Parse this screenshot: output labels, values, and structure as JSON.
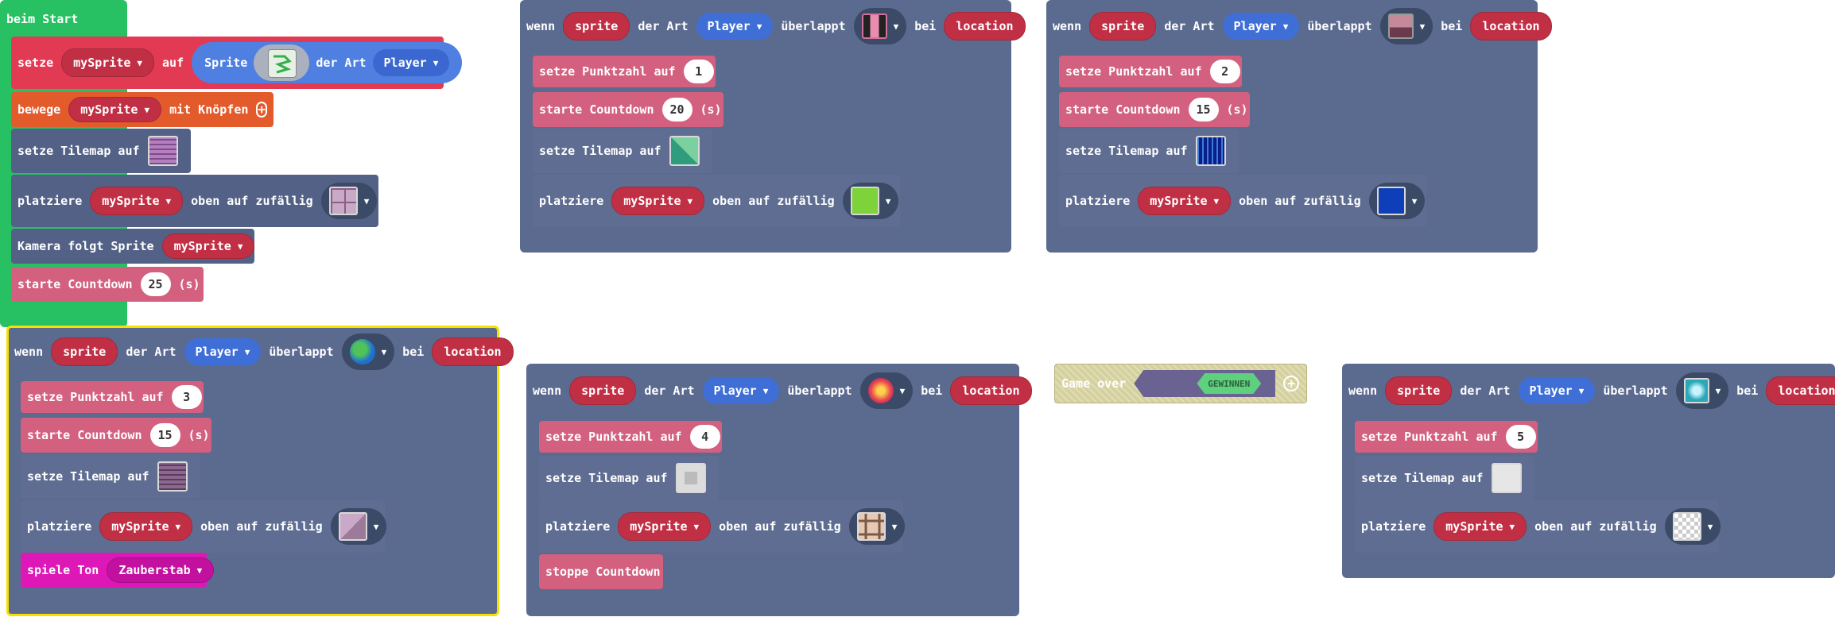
{
  "start_block": {
    "hat": "beim Start",
    "set_sprite": {
      "kw_set": "setze",
      "var": "mySprite",
      "kw_to": "auf",
      "kw_sprite": "Sprite",
      "kw_kind": "der Art",
      "kind": "Player"
    },
    "move": {
      "kw": "bewege",
      "var": "mySprite",
      "kw2": "mit Knöpfen"
    },
    "tilemap": {
      "kw": "setze Tilemap auf"
    },
    "place": {
      "kw": "platziere",
      "var": "mySprite",
      "kw2": "oben auf zufällig"
    },
    "camera": {
      "kw": "Kamera folgt Sprite",
      "var": "mySprite"
    },
    "countdown": {
      "kw": "starte Countdown",
      "value": "25",
      "unit": "(s)"
    }
  },
  "overlap_common": {
    "kw_when": "wenn",
    "sprite": "sprite",
    "kw_kind": "der Art",
    "kind": "Player",
    "kw_overlap": "überlappt",
    "kw_at": "bei",
    "location": "location"
  },
  "handlers": [
    {
      "score_label": "setze Punktzahl auf",
      "score": "1",
      "countdown_label": "starte Countdown",
      "countdown": "20",
      "unit": "(s)",
      "tilemap_label": "setze Tilemap auf",
      "place_label": "platziere",
      "var": "mySprite",
      "place_label2": "oben auf zufällig"
    },
    {
      "score_label": "setze Punktzahl auf",
      "score": "2",
      "countdown_label": "starte Countdown",
      "countdown": "15",
      "unit": "(s)",
      "tilemap_label": "setze Tilemap auf",
      "place_label": "platziere",
      "var": "mySprite",
      "place_label2": "oben auf zufällig"
    },
    {
      "score_label": "setze Punktzahl auf",
      "score": "3",
      "countdown_label": "starte Countdown",
      "countdown": "15",
      "unit": "(s)",
      "tilemap_label": "setze Tilemap auf",
      "place_label": "platziere",
      "var": "mySprite",
      "place_label2": "oben auf zufällig",
      "sound_label": "spiele Ton",
      "sound": "Zauberstab"
    },
    {
      "score_label": "setze Punktzahl auf",
      "score": "4",
      "tilemap_label": "setze Tilemap auf",
      "place_label": "platziere",
      "var": "mySprite",
      "place_label2": "oben auf zufällig",
      "stop_label": "stoppe Countdown"
    },
    {
      "score_label": "setze Punktzahl auf",
      "score": "5",
      "tilemap_label": "setze Tilemap auf",
      "place_label": "platziere",
      "var": "mySprite",
      "place_label2": "oben auf zufällig"
    }
  ],
  "game_over": {
    "label": "Game over",
    "value": "GEWINNEN"
  },
  "colors": {
    "events": "#27c063",
    "overlap": "#526185",
    "info": "#d3607f",
    "sprites": "#e23a52",
    "controller": "#e35a2b",
    "music": "#de18b6",
    "kind": "#3f6fd6",
    "selected": "#f5e000"
  }
}
